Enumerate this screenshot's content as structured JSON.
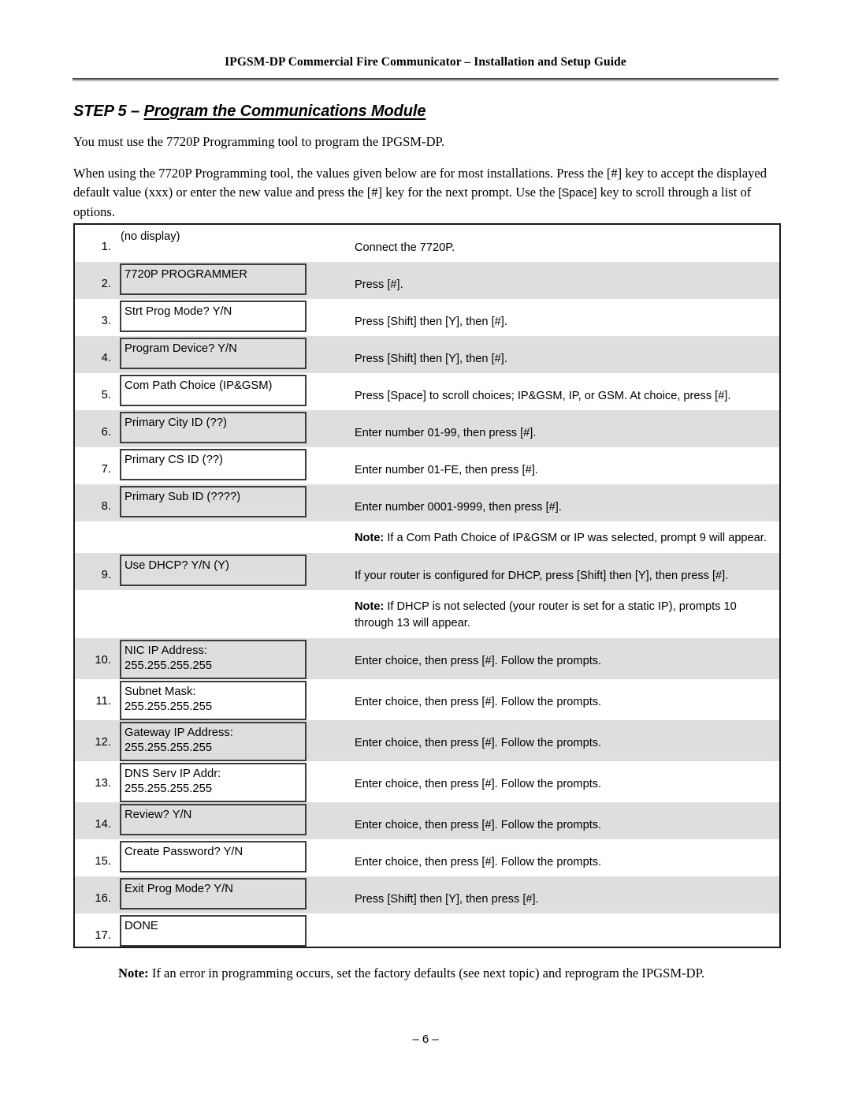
{
  "document": {
    "running_head": "IPGSM-DP Commercial Fire Communicator – Installation and Setup Guide",
    "page_number": "– 6 –"
  },
  "heading": {
    "prefix": "STEP 5 – ",
    "title": "Program the Communications Module"
  },
  "intro": {
    "paragraph1": "You must use the 7720P Programming tool to program the IPGSM-DP.",
    "paragraph2_part1": "When using the 7720P Programming tool, the values given below are for most installations.  Press the [#] key to accept the displayed default value (xxx) or enter the new value and press the [#] key for the next prompt.  Use the ",
    "paragraph2_kbd": "[Space]",
    "paragraph2_part2": " key to scroll through a list of options."
  },
  "table": {
    "rows": [
      {
        "kind": "step",
        "num": "1.",
        "display": "(no display)",
        "boxed": false,
        "action": "Connect the 7720P.",
        "shaded": false
      },
      {
        "kind": "step",
        "num": "2.",
        "display": "7720P PROGRAMMER",
        "boxed": true,
        "action": "Press [#].",
        "shaded": true
      },
      {
        "kind": "step",
        "num": "3.",
        "display": "Strt Prog Mode? Y/N",
        "boxed": true,
        "action": "Press [Shift] then [Y], then [#].",
        "shaded": false
      },
      {
        "kind": "step",
        "num": "4.",
        "display": "Program Device?  Y/N",
        "boxed": true,
        "action": "Press [Shift] then [Y], then [#].",
        "shaded": true
      },
      {
        "kind": "step",
        "num": "5.",
        "display": "Com Path Choice  (IP&GSM)",
        "boxed": true,
        "action": "Press [Space] to scroll choices; IP&GSM, IP, or GSM.  At choice, press [#].",
        "shaded": false
      },
      {
        "kind": "step",
        "num": "6.",
        "display": "Primary City ID  (??)",
        "boxed": true,
        "action": "Enter number 01-99, then press [#].",
        "shaded": true
      },
      {
        "kind": "step",
        "num": "7.",
        "display": "Primary CS ID  (??)",
        "boxed": true,
        "action": "Enter number 01-FE, then press [#].",
        "shaded": false
      },
      {
        "kind": "step",
        "num": "8.",
        "display": "Primary Sub ID  (????)",
        "boxed": true,
        "action": "Enter number 0001-9999, then press [#].",
        "shaded": true
      },
      {
        "kind": "note",
        "num": "",
        "display": "",
        "boxed": false,
        "note_label": "Note:",
        "action": " If a Com Path Choice of IP&GSM or IP was selected, prompt 9 will appear.",
        "shaded": false
      },
      {
        "kind": "step",
        "num": "9.",
        "display": "Use DHCP? Y/N (Y)",
        "boxed": true,
        "action": "If your router is configured for DHCP, press [Shift] then [Y], then press [#].",
        "shaded": true
      },
      {
        "kind": "note",
        "num": "",
        "display": "",
        "boxed": false,
        "note_label": "Note:",
        "action": " If DHCP is not selected (your router is set for a static IP), prompts 10 through 13 will appear.",
        "shaded": false
      },
      {
        "kind": "step",
        "num": "10.",
        "display": "NIC IP Address:\n255.255.255.255",
        "boxed": true,
        "action": "Enter choice, then press [#].  Follow the prompts.",
        "shaded": true
      },
      {
        "kind": "step",
        "num": "11.",
        "display": "Subnet Mask:\n255.255.255.255",
        "boxed": true,
        "action": "Enter choice, then press [#].  Follow the prompts.",
        "shaded": false
      },
      {
        "kind": "step",
        "num": "12.",
        "display": "Gateway IP Address:\n255.255.255.255",
        "boxed": true,
        "action": "Enter choice, then press [#].  Follow the prompts.",
        "shaded": true
      },
      {
        "kind": "step",
        "num": "13.",
        "display": "DNS Serv IP Addr:\n255.255.255.255",
        "boxed": true,
        "action": "Enter choice, then press [#].  Follow the prompts.",
        "shaded": false
      },
      {
        "kind": "step",
        "num": "14.",
        "display": "Review? Y/N",
        "boxed": true,
        "action": "Enter choice, then press [#].  Follow the prompts.",
        "shaded": true
      },
      {
        "kind": "step",
        "num": "15.",
        "display": "Create Password?  Y/N",
        "boxed": true,
        "action": "Enter choice, then press [#].  Follow the prompts.",
        "shaded": false
      },
      {
        "kind": "step",
        "num": "16.",
        "display": "Exit Prog Mode? Y/N",
        "boxed": true,
        "action": "Press [Shift] then [Y], then press [#].",
        "shaded": true
      },
      {
        "kind": "step",
        "num": "17.",
        "display": "DONE",
        "boxed": true,
        "action": "",
        "shaded": false
      }
    ]
  },
  "closing_note": {
    "label": "Note:",
    "text": " If an error in programming occurs, set the factory defaults (see next topic) and reprogram the IPGSM-DP."
  },
  "colors": {
    "shade": "#dedede",
    "rule": "#4a4a4a",
    "border": "#1a1a1a",
    "lcd_border": "#3c3c3c"
  }
}
